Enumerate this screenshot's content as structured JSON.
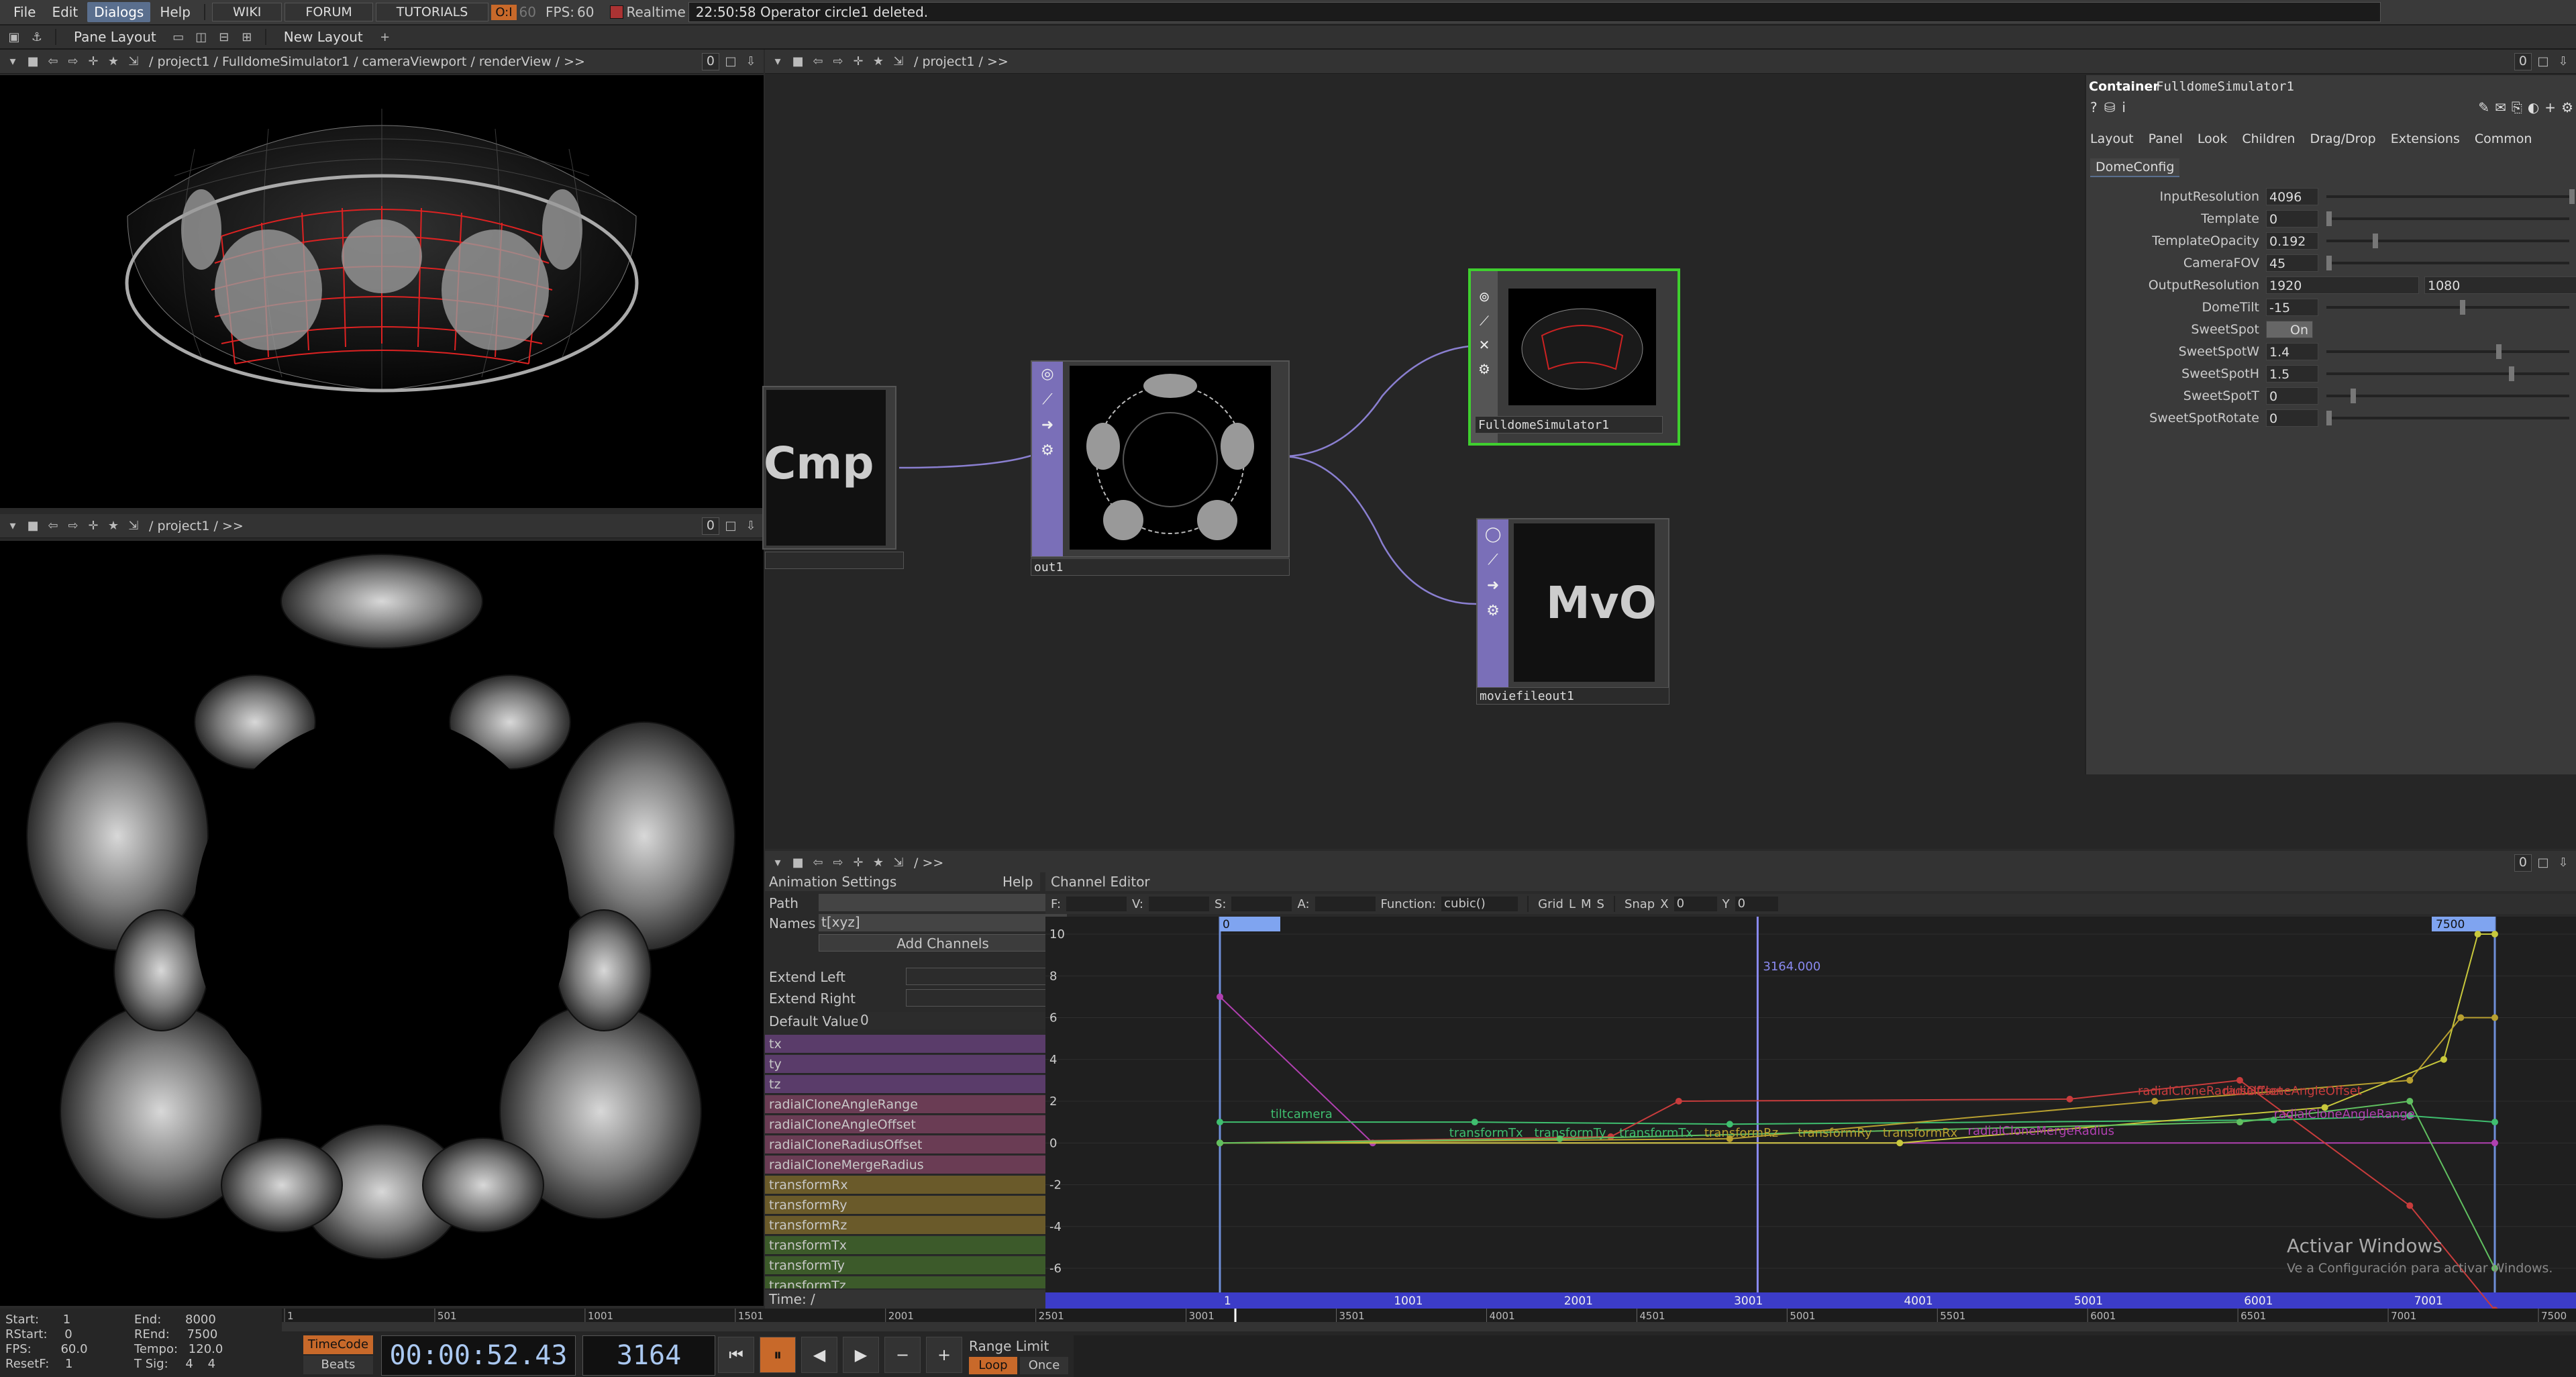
{
  "menubar": {
    "items": [
      "File",
      "Edit",
      "Dialogs",
      "Help"
    ],
    "links": [
      "WIKI",
      "FORUM",
      "TUTORIALS"
    ],
    "perf_badge": "O:I",
    "perf_dim": "60",
    "fps_label": "FPS:",
    "fps_value": "60",
    "realtime_label": "Realtime",
    "status": "22:50:58 Operator circle1 deleted."
  },
  "bar2": {
    "pane_layout": "Pane Layout",
    "new_layout": "New Layout"
  },
  "viewer_top": {
    "path": "/ project1 / FulldomeSimulator1 / cameraViewport / renderView / >>",
    "num": "0"
  },
  "viewer_bottom": {
    "path": "/ project1 / >>",
    "num": "0"
  },
  "network": {
    "path": "/ project1 / >>",
    "num": "0",
    "nodes": {
      "cmp": "Cmp",
      "out": "out1",
      "fulldome": "FulldomeSimulator1",
      "mvo": "MvO",
      "moviefile": "moviefileout1"
    }
  },
  "params": {
    "type": "Container",
    "name": "FulldomeSimulator1",
    "tabs": [
      "Layout",
      "Panel",
      "Look",
      "Children",
      "Drag/Drop",
      "Extensions",
      "Common"
    ],
    "subtab": "DomeConfig",
    "rows": [
      {
        "label": "InputResolution",
        "value": "4096",
        "knob": 1.0
      },
      {
        "label": "Template",
        "value": "0",
        "knob": 0.0
      },
      {
        "label": "TemplateOpacity",
        "value": "0.192",
        "knob": 0.19
      },
      {
        "label": "CameraFOV",
        "value": "45",
        "knob": 0.0
      },
      {
        "label": "OutputResolution",
        "value": "1920",
        "value2": "1080"
      },
      {
        "label": "DomeTilt",
        "value": "-15",
        "knob": 0.55
      },
      {
        "label": "SweetSpot",
        "toggle": "On"
      },
      {
        "label": "SweetSpotW",
        "value": "1.4",
        "knob": 0.7
      },
      {
        "label": "SweetSpotH",
        "value": "1.5",
        "knob": 0.75
      },
      {
        "label": "SweetSpotT",
        "value": "0",
        "knob": 0.1
      },
      {
        "label": "SweetSpotRotate",
        "value": "0",
        "knob": 0.0
      }
    ]
  },
  "anim": {
    "path": "/ >>",
    "num": "0",
    "settings_title": "Animation Settings",
    "help": "Help",
    "editor_title": "Channel Editor",
    "path_label": "Path",
    "names_label": "Names",
    "names_value": "t[xyz]",
    "add_channels": "Add Channels",
    "extend_left": "Extend Left",
    "extend_right": "Extend Right",
    "default_value": "Default Value",
    "default_value_val": "0",
    "time_label": "Time: /",
    "channels": [
      {
        "name": "tx",
        "color": "#5a3c6a"
      },
      {
        "name": "ty",
        "color": "#5a3c6a"
      },
      {
        "name": "tz",
        "color": "#5a3c6a"
      },
      {
        "name": "radialCloneAngleRange",
        "color": "#6a3c54"
      },
      {
        "name": "radialCloneAngleOffset",
        "color": "#6a3c54"
      },
      {
        "name": "radialCloneRadiusOffset",
        "color": "#6a3c54"
      },
      {
        "name": "radialCloneMergeRadius",
        "color": "#6a3c54"
      },
      {
        "name": "transformRx",
        "color": "#6a5a2a"
      },
      {
        "name": "transformRy",
        "color": "#6a5a2a"
      },
      {
        "name": "transformRz",
        "color": "#6a5a2a"
      },
      {
        "name": "transformTx",
        "color": "#3c5a2a"
      },
      {
        "name": "transformTy",
        "color": "#3c5a2a"
      },
      {
        "name": "transformTz",
        "color": "#3c5a2a"
      }
    ],
    "toolbar": {
      "f": "F:",
      "v": "V:",
      "s": "S:",
      "a": "A:",
      "function_label": "Function:",
      "function_value": "cubic()",
      "grid": "Grid",
      "l": "L",
      "m": "M",
      "s2": "S",
      "snap": "Snap",
      "x": "X",
      "xv": "0",
      "y": "Y",
      "yv": "0"
    },
    "curve_labels": [
      "tiltcamera",
      "transformTx",
      "transformTy",
      "transformTx",
      "transformRz",
      "transformRy",
      "transformRx",
      "radialCloneMergeRadius",
      "radialCloneRadiusOffset",
      "radialCloneAngleOffset",
      "radialCloneAngleRange"
    ],
    "marker_start": "0",
    "marker_end": "7500",
    "cursor_value": "3164.000",
    "yticks": [
      "10",
      "8",
      "6",
      "4",
      "2",
      "0",
      "-2",
      "-4",
      "-6"
    ],
    "xticks": [
      "1",
      "1001",
      "2001",
      "3001",
      "4001",
      "5001",
      "6001",
      "7001"
    ],
    "watermark1": "Activar Windows",
    "watermark2": "Ve a Configuración para activar Windows."
  },
  "timeline": {
    "start_label": "Start:",
    "start": "1",
    "end_label": "End:",
    "end": "8000",
    "rstart_label": "RStart:",
    "rstart": "0",
    "rend_label": "REnd:",
    "rend": "7500",
    "fps_label": "FPS:",
    "fps": "60.0",
    "tempo_label": "Tempo:",
    "tempo": "120.0",
    "resetf_label": "ResetF:",
    "resetf": "1",
    "tsig_label": "T Sig:",
    "tsig1": "4",
    "tsig2": "4",
    "timecode_btn": "TimeCode",
    "beats_btn": "Beats",
    "timecode": "00:00:52.43",
    "frame": "3164",
    "range_limit": "Range Limit",
    "loop": "Loop",
    "once": "Once",
    "ruler": [
      "1",
      "501",
      "1001",
      "1501",
      "2001",
      "2501",
      "3001",
      "3501",
      "4001",
      "4501",
      "5001",
      "5501",
      "6001",
      "6501",
      "7001",
      "7500"
    ]
  },
  "colors": {
    "accent": "#5a6f8e",
    "node_purple": "#7a6fb8",
    "selected": "#3fcf2f",
    "orange": "#c8692a"
  }
}
